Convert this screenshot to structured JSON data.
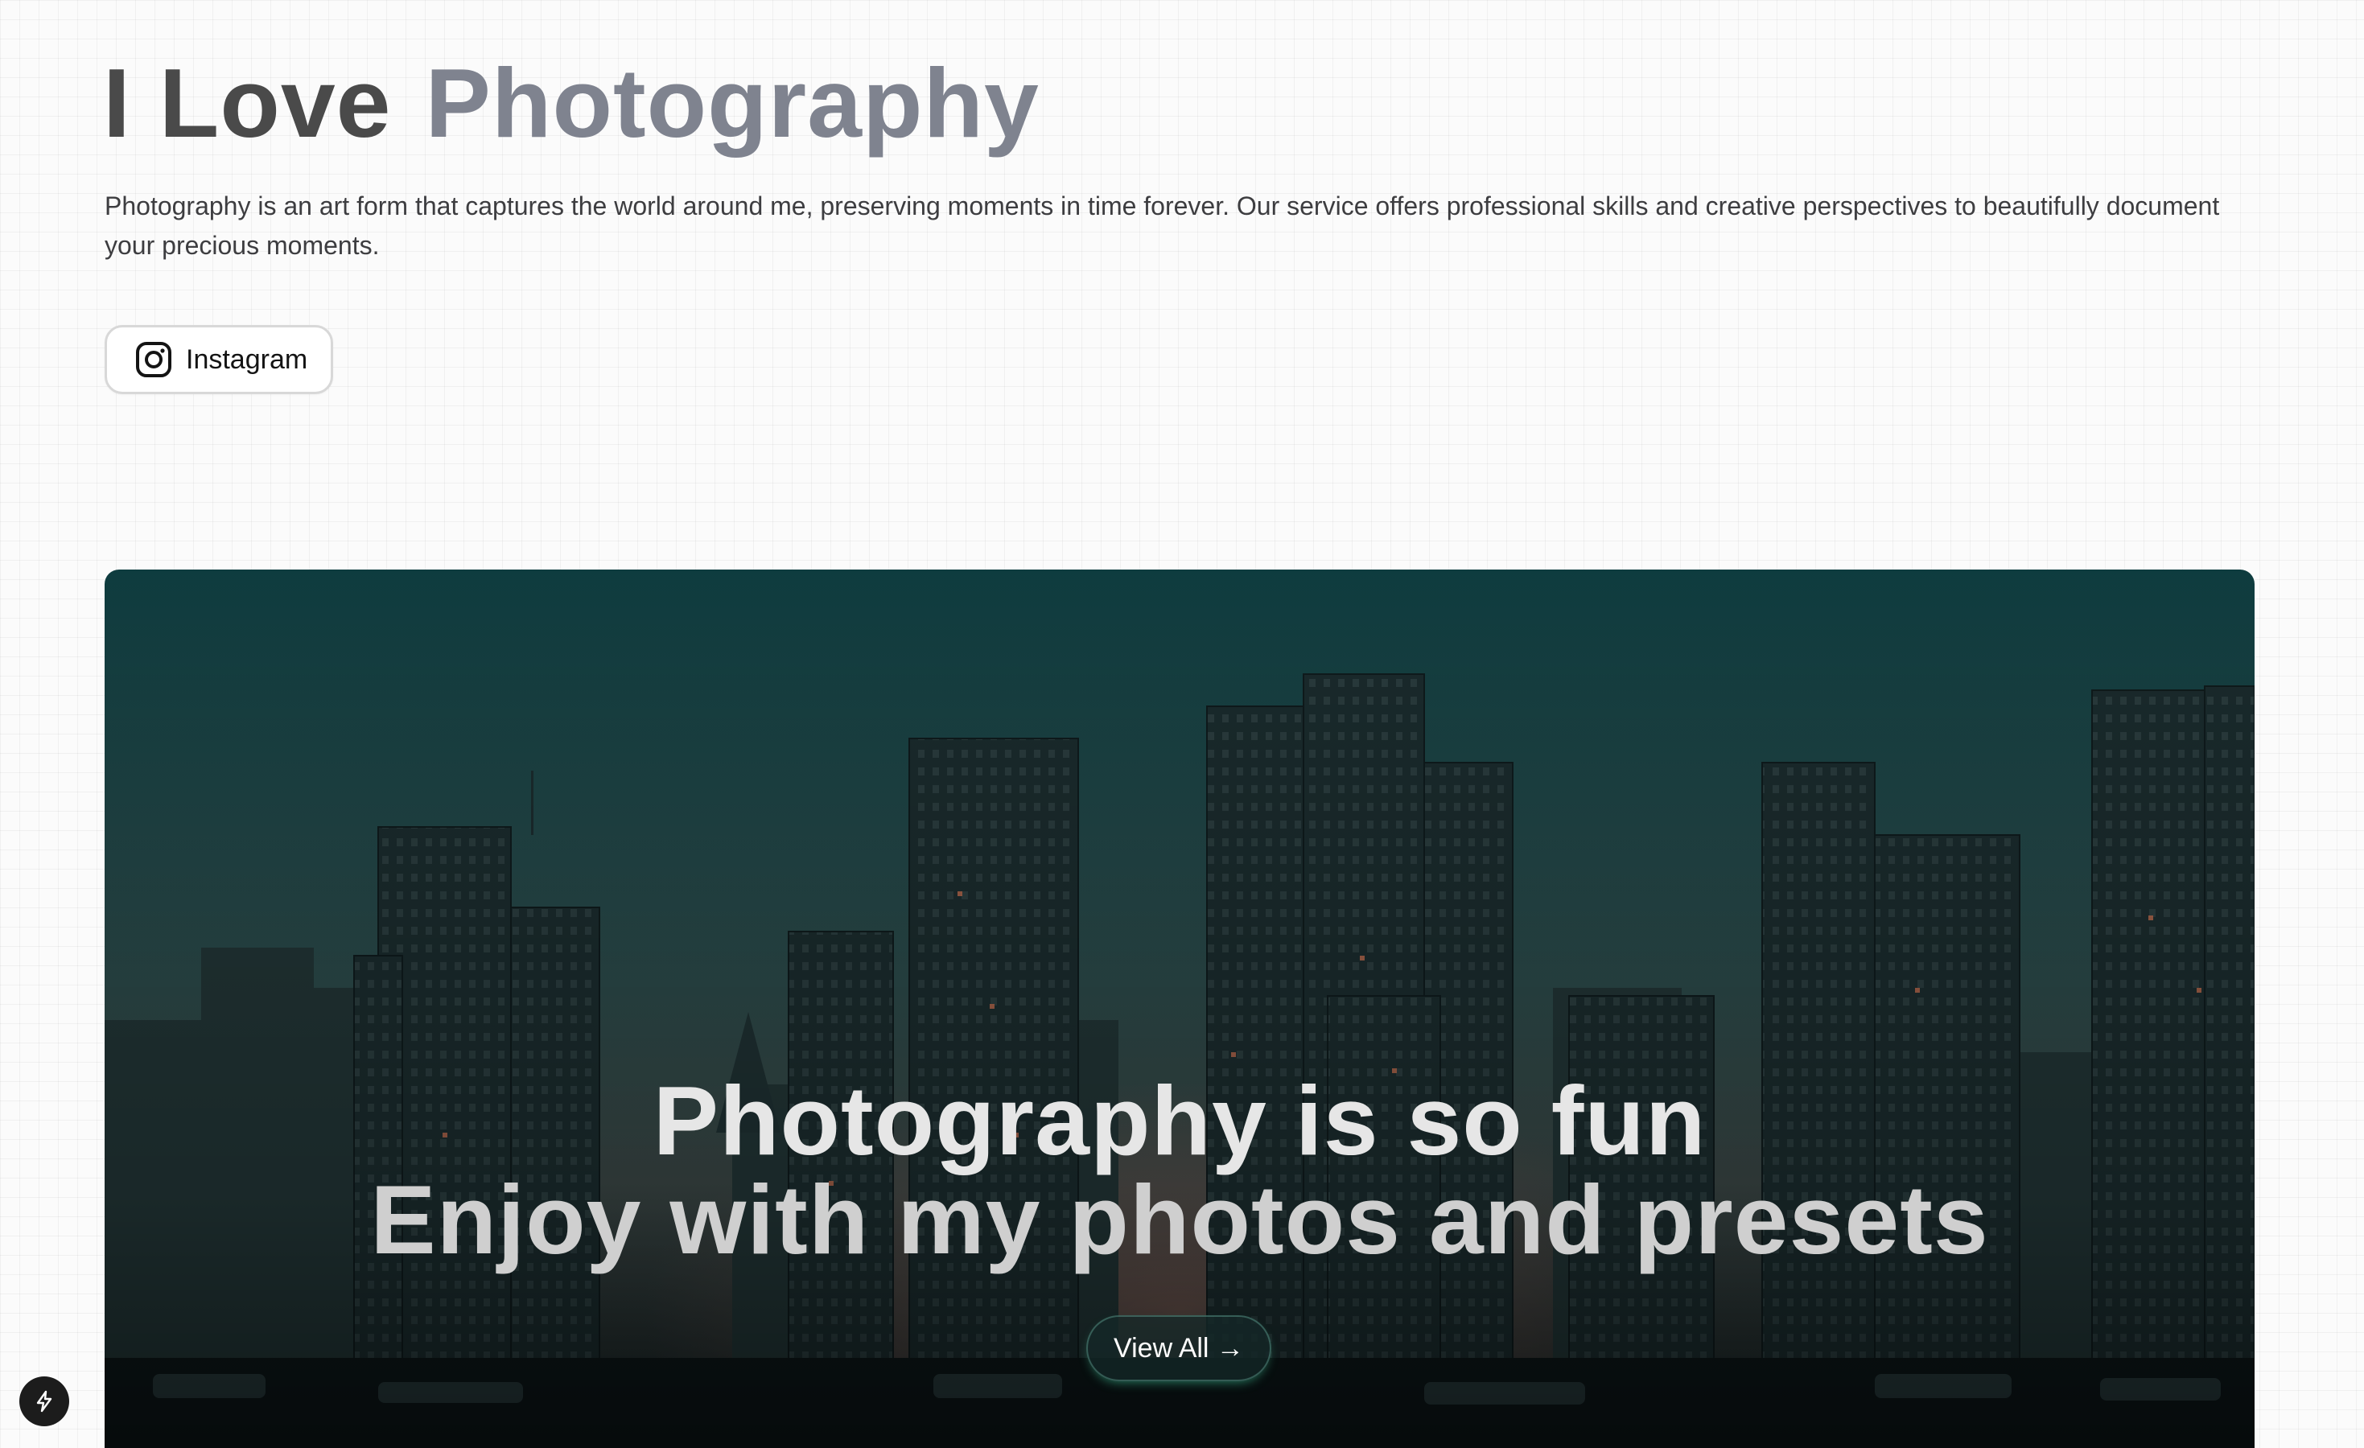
{
  "header": {
    "title_part1": "I Love",
    "title_part2": "Photography",
    "description": "Photography is an art form that captures the world around me, preserving moments in time forever. Our service offers professional skills and creative perspectives to beautifully document your precious moments."
  },
  "social": {
    "instagram_label": "Instagram",
    "icon": "instagram-icon"
  },
  "banner": {
    "heading_line1": "Photography is so fun",
    "heading_line2": "Enjoy with my photos and presets",
    "button_label": "View All →"
  },
  "dev_badge": {
    "icon": "lightning-icon"
  },
  "colors": {
    "title_dark": "#4a4a4a",
    "title_light": "#7f838f",
    "banner_sky_top": "#0f3f42",
    "banner_ground": "#0a1416"
  }
}
